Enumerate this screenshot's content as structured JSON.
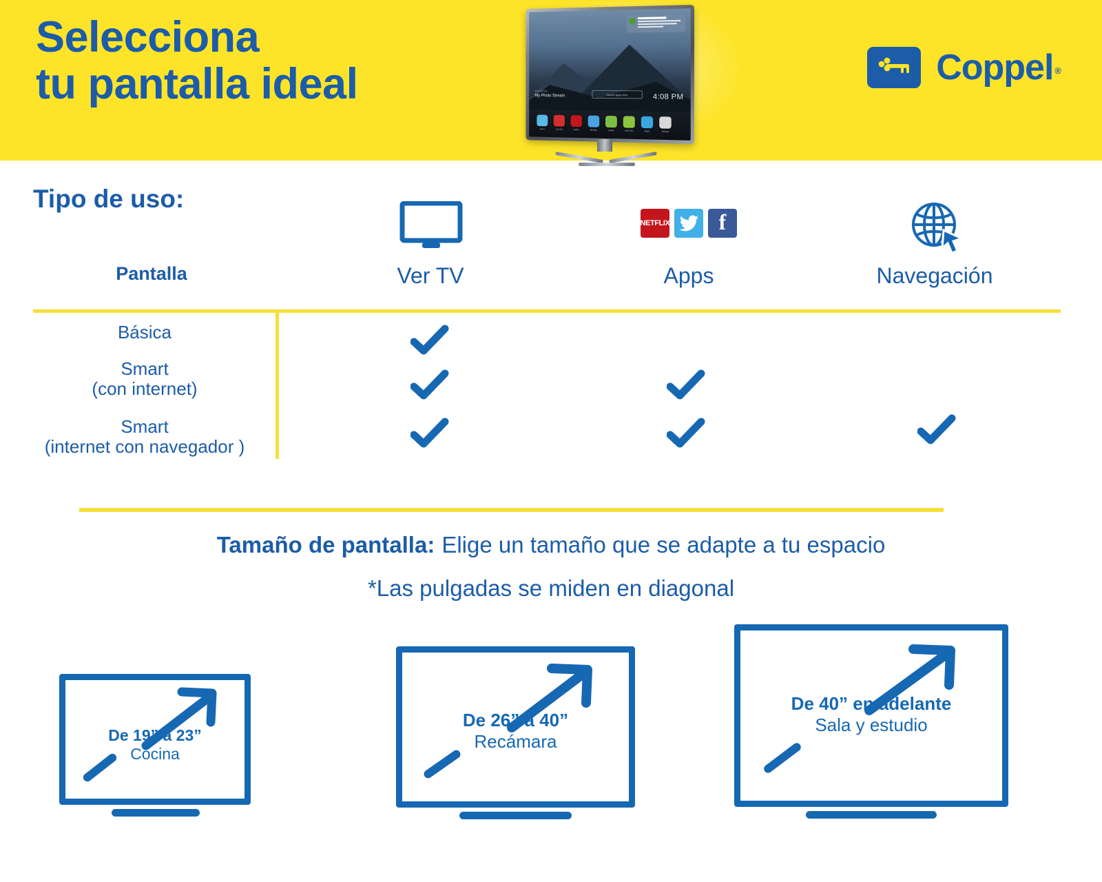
{
  "colors": {
    "brand_yellow": "#fde428",
    "brand_blue": "#1c5ca8",
    "accent_blue": "#1668b3",
    "rule_yellow": "#f5e03c",
    "netflix_red": "#c3161c",
    "twitter_blue": "#41b0e8",
    "facebook_blue": "#3b5998"
  },
  "header": {
    "title_line1": "Selecciona",
    "title_line2": "tu pantalla ideal",
    "logo_text": "Coppel",
    "logo_registered": "®",
    "tv_photo": {
      "stream_eyebrow": "MY PHOTOS",
      "stream_title": "My Photo Stream",
      "search_placeholder": "Search apps here",
      "clock": "4:08 PM",
      "notification_title": "Megabox Alerta",
      "apps": [
        {
          "name": "Home",
          "color": "#58b8e8"
        },
        {
          "name": "YouTube",
          "color": "#d32f2f"
        },
        {
          "name": "Netflix",
          "color": "#c3161c"
        },
        {
          "name": "Blu-Ray",
          "color": "#4ba3e3"
        },
        {
          "name": "Spotify",
          "color": "#7cc043"
        },
        {
          "name": "Hulu Plus",
          "color": "#8bc53f"
        },
        {
          "name": "Skype",
          "color": "#38a7e0"
        },
        {
          "name": "Settings",
          "color": "#d8d8d8"
        }
      ]
    }
  },
  "usage_section": {
    "section_label": "Tipo de uso:",
    "columns": [
      {
        "key": "pantalla",
        "label": "Pantalla",
        "icon": null
      },
      {
        "key": "vertv",
        "label": "Ver TV",
        "icon": "tv-monitor-icon"
      },
      {
        "key": "apps",
        "label": "Apps",
        "icon": "app-logos-icon"
      },
      {
        "key": "navegacion",
        "label": "Navegación",
        "icon": "globe-cursor-icon"
      }
    ],
    "app_icons": [
      {
        "name": "netflix-icon",
        "label": "NETFLIX"
      },
      {
        "name": "twitter-icon",
        "label": ""
      },
      {
        "name": "facebook-icon",
        "label": "f"
      }
    ],
    "rows": [
      {
        "label_line1": "Básica",
        "label_line2": "",
        "vertv": true,
        "apps": false,
        "navegacion": false
      },
      {
        "label_line1": "Smart",
        "label_line2": "(con internet)",
        "vertv": true,
        "apps": true,
        "navegacion": false
      },
      {
        "label_line1": "Smart",
        "label_line2": "(internet con navegador )",
        "vertv": true,
        "apps": true,
        "navegacion": true
      }
    ]
  },
  "size_section": {
    "lead": "Tamaño de pantalla:",
    "headline": "Elige un tamaño que se adapte a tu espacio",
    "note": "*Las pulgadas se miden en diagonal",
    "boxes": [
      {
        "size": "De 19” a 23”",
        "room": "Cocina"
      },
      {
        "size": "De 26” a 40”",
        "room": "Recámara"
      },
      {
        "size": "De 40” en adelante",
        "room": "Sala y estudio"
      }
    ]
  }
}
